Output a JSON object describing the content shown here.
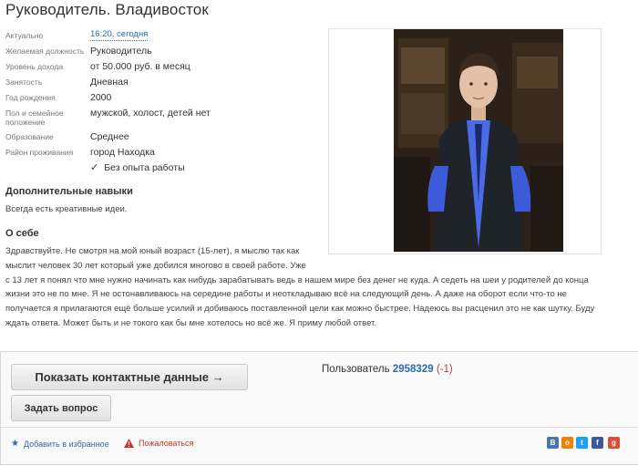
{
  "title": "Руководитель. Владивосток",
  "details": [
    {
      "label": "Актуально",
      "value": "16:20, сегодня",
      "link": true
    },
    {
      "label": "Желаемая должность",
      "value": "Руководитель"
    },
    {
      "label": "Уровень дохода",
      "value": "от 50.000 руб. в месяц"
    },
    {
      "label": "Занятость",
      "value": "Дневная"
    },
    {
      "label": "Год рождения",
      "value": "2000"
    },
    {
      "label": "Пол и семейное положение",
      "value": "мужской, холост, детей нет"
    },
    {
      "label": "Образование",
      "value": "Среднее"
    },
    {
      "label": "Район проживания",
      "value": "город Находка"
    }
  ],
  "experience": "Без опыта работы",
  "skills": {
    "heading": "Дополнительные навыки",
    "text": "Всегда есть креативные идеи."
  },
  "about": {
    "heading": "О себе",
    "lines": [
      "Здравствуйте. Не смотря на мой юный возраст (15-лет), я мыслю так как",
      "мыслит человек 30 лет который уже добился многово в своей работе. Уже",
      "с 13 лет я понял что мне нужно начинать как нибудь зарабатывать ведь в нашем мире без денег не куда. А седеть на шеи у родителей до конца",
      "жизни это не по мне. Я не остонавливаюсь на середине работы и неоткладываю всё на следующий день. А даже на оборот если что-то не",
      "получается я прилагаются ещё больше усилий и добиваюсь поставленной цели как можно быстрее. Надеюсь вы расценил это не как шутку. Буду",
      "ждать ответа. Может быть и не токого как бы мне хотелось но всё же. Я приму любой ответ."
    ]
  },
  "actions": {
    "show_contacts": "Показать контактные данные →",
    "ask_question": "Задать вопрос",
    "user_label": "Пользователь",
    "user_id": "2958329",
    "user_rating": "(-1)",
    "favorite": "Добавить в избранное",
    "complain": "Пожаловаться"
  },
  "social": [
    {
      "icon": "vk-icon",
      "glyph": "B",
      "color": "#4a76a8"
    },
    {
      "icon": "odnoklassniki-icon",
      "glyph": "o",
      "color": "#ee8208"
    },
    {
      "icon": "twitter-icon",
      "glyph": "t",
      "color": "#1da1f2"
    },
    {
      "icon": "facebook-icon",
      "glyph": "f",
      "color": "#3b5998"
    },
    {
      "icon": "google-plus-icon",
      "glyph": "g",
      "color": "#dd4b39"
    }
  ]
}
